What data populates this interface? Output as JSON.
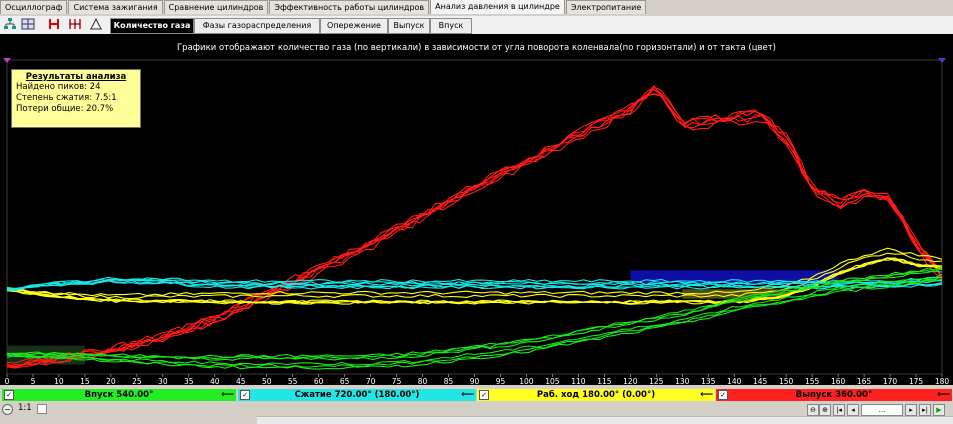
{
  "main_tabs": [
    "Осциллограф",
    "Система зажигания",
    "Сравнение цилиндров",
    "Эффективность работы цилиндров",
    "Анализ давления в цилиндре",
    "Электропитание"
  ],
  "main_tab_active": 4,
  "sub_tabs": [
    "Количество газа",
    "Фазы газораспределения",
    "Опережение",
    "Выпуск",
    "Впуск"
  ],
  "sub_tab_active": 0,
  "chart_title": "Графики отображают количество газа (по вертикали) в зависимости от угла поворота коленвала(по горизонтали) и от такта (цвет)",
  "results": {
    "heading": "Результаты анализа",
    "lines": [
      "Найдено пиков: 24",
      "Степень сжатия: 7.5:1",
      "Потери общие: 20.7%"
    ]
  },
  "phases": [
    {
      "label": "Впуск 540.00°",
      "color": "#22ee22",
      "checked": true
    },
    {
      "label": "Сжатие 720.00° (180.00°)",
      "color": "#22e6e6",
      "checked": true
    },
    {
      "label": "Раб. ход 180.00° (0.00°)",
      "color": "#ffff22",
      "checked": true
    },
    {
      "label": "Выпуск 360.00°",
      "color": "#ff2020",
      "checked": true
    }
  ],
  "status": {
    "zoom": "1:1",
    "nav_value": "..."
  },
  "chart_data": {
    "type": "line",
    "title": "Графики отображают количество газа (по вертикали) в зависимости от угла поворота коленвала(по горизонтали) и от такта (цвет)",
    "xlabel": "",
    "ylabel": "",
    "xlim": [
      0,
      180
    ],
    "ylim": [
      0,
      1
    ],
    "x_ticks": [
      0,
      5,
      10,
      15,
      20,
      25,
      30,
      35,
      40,
      45,
      50,
      55,
      60,
      65,
      70,
      75,
      80,
      85,
      90,
      95,
      100,
      105,
      110,
      115,
      120,
      125,
      130,
      135,
      140,
      145,
      150,
      155,
      160,
      165,
      170,
      175,
      180
    ],
    "grid": false,
    "series": [
      {
        "color": "#ff1a1a",
        "count": 6,
        "x": [
          0,
          10,
          20,
          30,
          40,
          50,
          60,
          70,
          80,
          90,
          100,
          110,
          120,
          125,
          130,
          140,
          145,
          150,
          155,
          160,
          165,
          170,
          175,
          180
        ],
        "values": [
          0.03,
          0.05,
          0.08,
          0.12,
          0.18,
          0.26,
          0.34,
          0.42,
          0.51,
          0.6,
          0.68,
          0.77,
          0.85,
          0.92,
          0.8,
          0.82,
          0.83,
          0.76,
          0.6,
          0.55,
          0.58,
          0.57,
          0.42,
          0.32
        ]
      },
      {
        "color": "#ffff1a",
        "count": 6,
        "x": [
          0,
          10,
          20,
          30,
          40,
          50,
          60,
          70,
          80,
          90,
          100,
          110,
          120,
          130,
          140,
          145,
          150,
          155,
          160,
          165,
          170,
          175,
          180
        ],
        "values": [
          0.27,
          0.25,
          0.24,
          0.24,
          0.24,
          0.24,
          0.24,
          0.24,
          0.24,
          0.24,
          0.24,
          0.24,
          0.24,
          0.24,
          0.24,
          0.25,
          0.26,
          0.29,
          0.33,
          0.36,
          0.38,
          0.36,
          0.35
        ]
      },
      {
        "color": "#1ae6e6",
        "count": 6,
        "x": [
          0,
          10,
          20,
          30,
          40,
          50,
          60,
          70,
          80,
          90,
          100,
          110,
          120,
          130,
          140,
          150,
          160,
          170,
          180
        ],
        "values": [
          0.27,
          0.29,
          0.3,
          0.3,
          0.29,
          0.29,
          0.29,
          0.29,
          0.29,
          0.29,
          0.29,
          0.29,
          0.29,
          0.29,
          0.29,
          0.29,
          0.29,
          0.29,
          0.3
        ]
      },
      {
        "color": "#1ae61a",
        "count": 6,
        "x": [
          0,
          10,
          20,
          30,
          40,
          50,
          60,
          70,
          80,
          90,
          100,
          110,
          120,
          130,
          140,
          150,
          160,
          170,
          180
        ],
        "values": [
          0.06,
          0.06,
          0.05,
          0.045,
          0.04,
          0.04,
          0.04,
          0.04,
          0.05,
          0.07,
          0.09,
          0.12,
          0.15,
          0.18,
          0.22,
          0.25,
          0.28,
          0.3,
          0.32
        ]
      }
    ],
    "regions": [
      {
        "color": "#1a3a1a",
        "x": [
          0,
          15
        ],
        "y": [
          0.03,
          0.09
        ]
      },
      {
        "color": "#1010c0",
        "x": [
          120,
          160
        ],
        "y": [
          0.29,
          0.33
        ]
      },
      {
        "color": "#5a5a1a",
        "x": [
          130,
          150
        ],
        "y": [
          0.24,
          0.27
        ]
      }
    ]
  }
}
